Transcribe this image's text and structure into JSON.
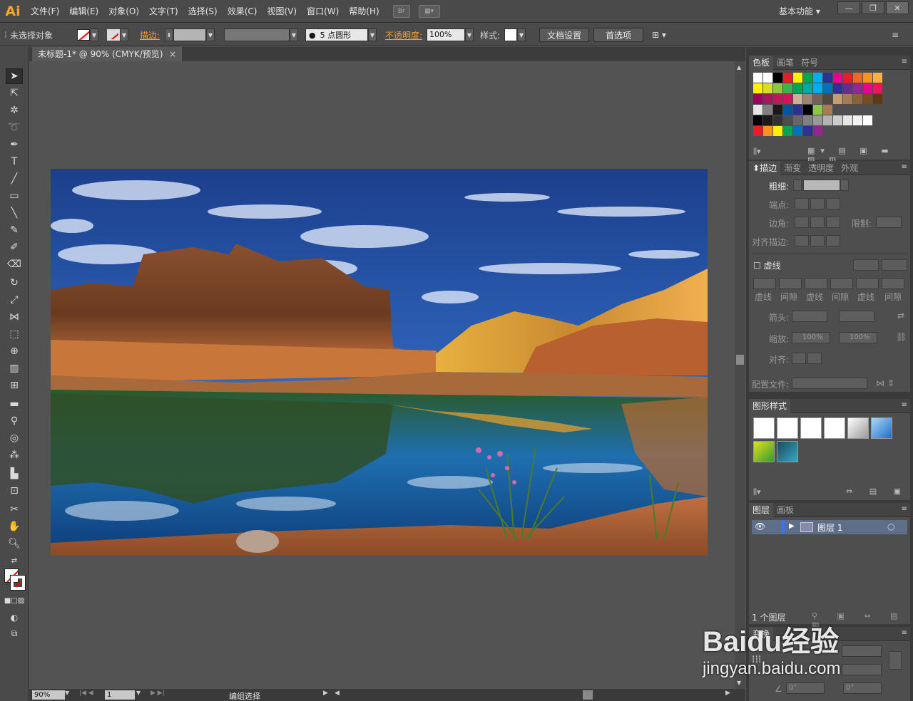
{
  "app": {
    "logo": "Ai",
    "menus": [
      "文件(F)",
      "编辑(E)",
      "对象(O)",
      "文字(T)",
      "选择(S)",
      "效果(C)",
      "视图(V)",
      "窗口(W)",
      "帮助(H)"
    ],
    "bridge_label": "Br",
    "workspace": "基本功能 ▾",
    "window_buttons": [
      "—",
      "❐",
      "✕"
    ]
  },
  "control": {
    "selection_label": "未选择对象",
    "stroke_label": "描边:",
    "brush_label": "5 点圆形",
    "opacity_label": "不透明度:",
    "opacity_value": "100%",
    "style_label": "样式:",
    "doc_setup": "文档设置",
    "prefs": "首选项"
  },
  "document": {
    "tab_title": "未标题-1* @ 90% (CMYK/预览)",
    "tab_close": "×",
    "zoom": "90%",
    "page": "1",
    "status": "编组选择"
  },
  "swatches_panel": {
    "tabs": [
      "色板",
      "画笔",
      "符号"
    ],
    "rows": [
      [
        "#ffffff",
        "#ffffff",
        "#000000",
        "#e31e24",
        "#fff200",
        "#00a651",
        "#00aeef",
        "#2e3192",
        "#ec008c",
        "#ed1c24",
        "#f26522",
        "#f7941d",
        "#fbb040"
      ],
      [
        "#fff200",
        "#d7df23",
        "#8dc63f",
        "#39b54a",
        "#00a651",
        "#00a99d",
        "#00aeef",
        "#0072bc",
        "#2e3192",
        "#662d91",
        "#92278f",
        "#ec008c",
        "#ed145b"
      ],
      [
        "#9e005d",
        "#a3195b",
        "#c2185b",
        "#d4145a",
        "#c7b299",
        "#998675",
        "#736357",
        "#534741",
        "#c69c6d",
        "#a67c52",
        "#8c6239",
        "#754c24",
        "#603913"
      ],
      [
        "#e6e6e6",
        "#808080",
        "#1a1a1a",
        "#0054a6",
        "#2e3192",
        "#000000",
        "#8dc63f",
        "#a67c52"
      ],
      [
        "#000000",
        "#1a1a1a",
        "#333333",
        "#4d4d4d",
        "#666666",
        "#808080",
        "#999999",
        "#b3b3b3",
        "#cccccc",
        "#e6e6e6",
        "#f2f2f2",
        "#ffffff"
      ],
      [
        "#ed1c24",
        "#f7941d",
        "#fff200",
        "#00a651",
        "#0072bc",
        "#2e3192",
        "#92278f"
      ]
    ]
  },
  "stroke_panel": {
    "tabs": [
      "描边",
      "渐变",
      "透明度",
      "外观"
    ],
    "weight_label": "粗细:",
    "cap_label": "端点:",
    "corner_label": "边角:",
    "limit_label": "限制:",
    "align_label": "对齐描边:",
    "dashed_label": "虚线",
    "dash_labels": [
      "虚线",
      "间隙",
      "虚线",
      "间隙",
      "虚线",
      "间隙"
    ],
    "arrow_label": "箭头:",
    "scale_label": "缩放:",
    "scale_a": "100%",
    "scale_b": "100%",
    "arrow_align_label": "对齐:",
    "profile_label": "配置文件:"
  },
  "graphic_styles_panel": {
    "tabs": [
      "图形样式"
    ]
  },
  "layers_panel": {
    "tabs": [
      "图层",
      "画板"
    ],
    "layer_name": "图层 1",
    "count": "1 个图层"
  },
  "transform_panel": {
    "tabs": [
      "变换"
    ],
    "angle_a": "0°",
    "angle_b": "0°"
  },
  "watermark": {
    "logo": "Baidu经验",
    "url": "jingyan.baidu.com"
  }
}
